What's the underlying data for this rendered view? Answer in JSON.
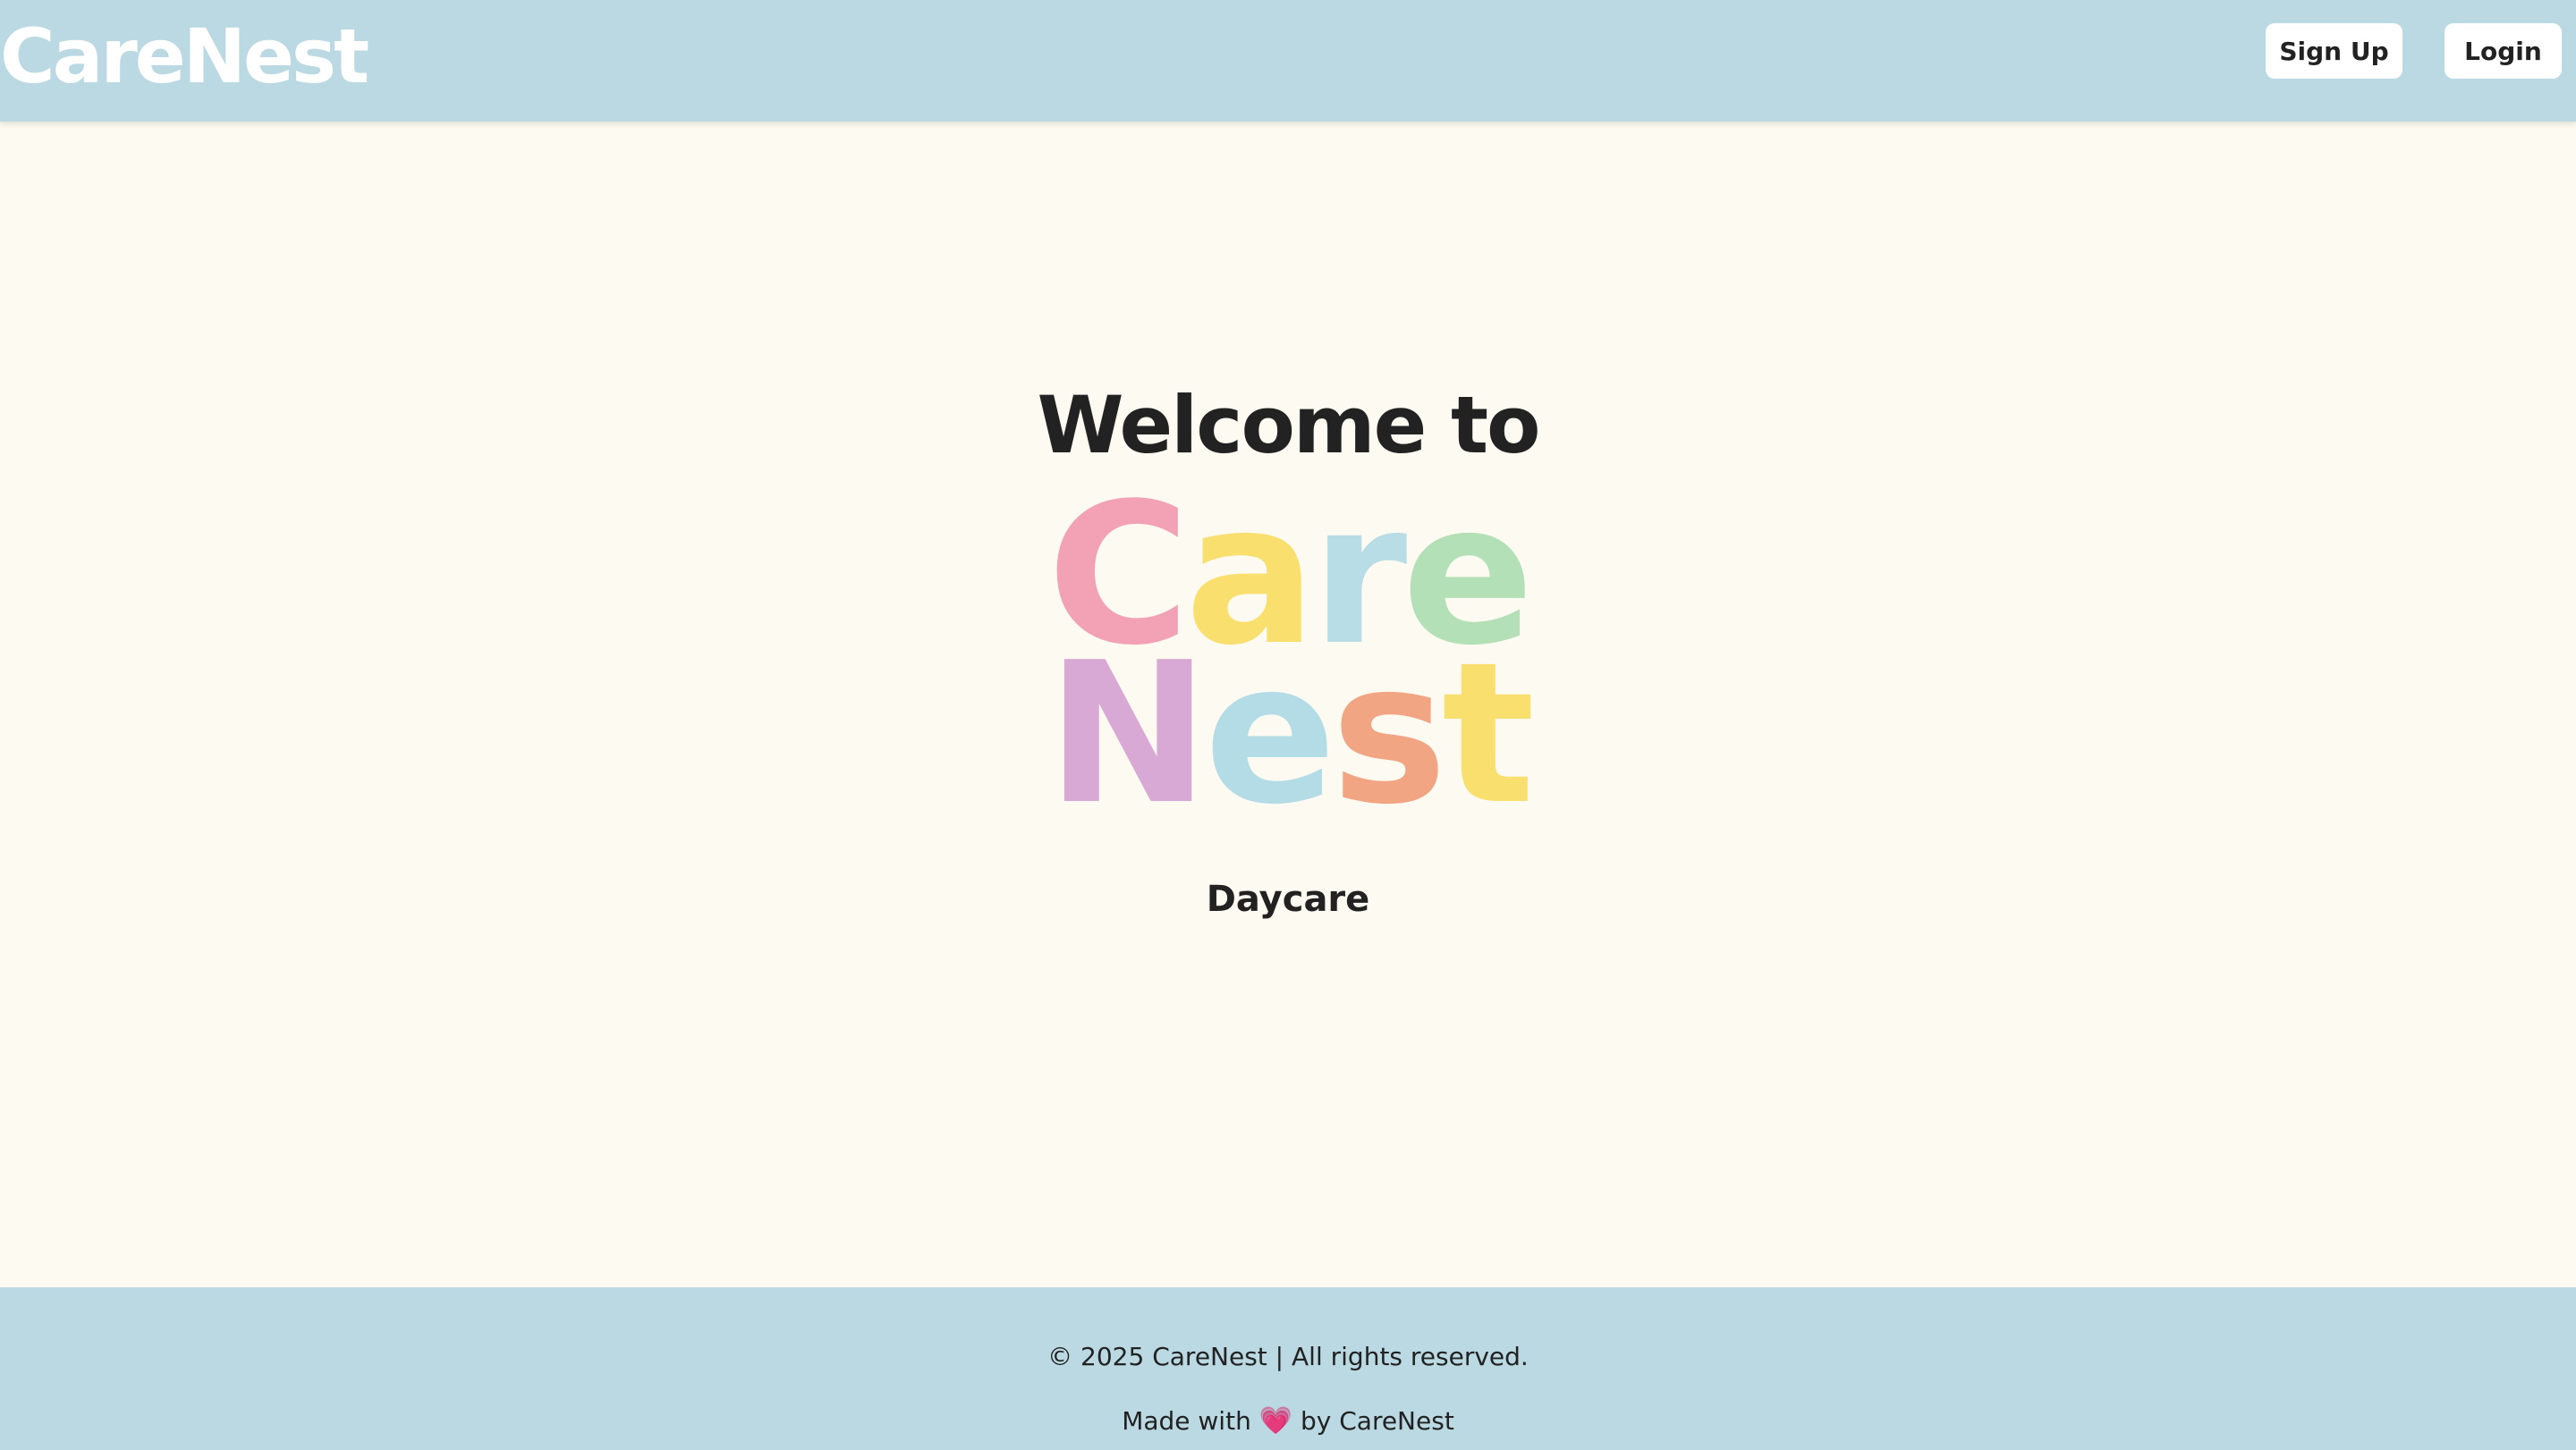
{
  "header": {
    "brand": "CareNest",
    "signup_label": "Sign Up",
    "login_label": "Login"
  },
  "hero": {
    "welcome": "Welcome to",
    "logo_line_1": [
      {
        "letter": "C",
        "color": "#F2A2B4"
      },
      {
        "letter": "a",
        "color": "#F9E06E"
      },
      {
        "letter": "r",
        "color": "#B8DDE7"
      },
      {
        "letter": "e",
        "color": "#B3E0B6"
      }
    ],
    "logo_line_2": [
      {
        "letter": "N",
        "color": "#D9A9D6"
      },
      {
        "letter": "e",
        "color": "#B3DCE7"
      },
      {
        "letter": "s",
        "color": "#F2A583"
      },
      {
        "letter": "t",
        "color": "#F9E06E"
      }
    ],
    "tagline": "Daycare"
  },
  "footer": {
    "copyright": "© 2025 CareNest | All rights reserved.",
    "made_prefix": "Made with",
    "made_suffix": "by CareNest",
    "heart_icon": "heart-icon"
  },
  "colors": {
    "header_bg": "#BAD9E2",
    "page_bg": "#FDFAF2",
    "text": "#222222",
    "heart": "#E0469B"
  }
}
